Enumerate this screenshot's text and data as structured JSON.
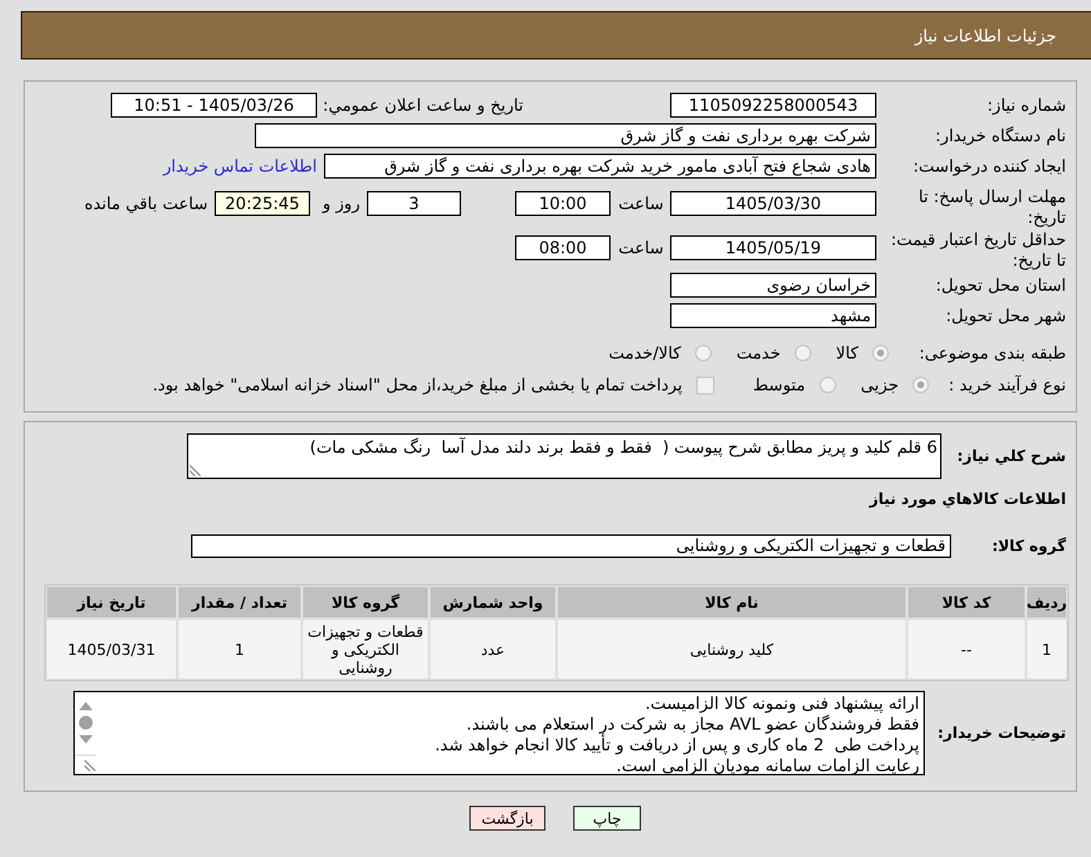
{
  "header": {
    "title": "جزئیات اطلاعات نیاز"
  },
  "details": {
    "need_number": {
      "label": "شماره نیاز:",
      "value": "1105092258000543"
    },
    "announcement": {
      "label": "تاریخ و ساعت اعلان عمومي:",
      "value": "1405/03/26 - 10:51"
    },
    "buyer_org": {
      "label": "نام دستگاه خریدار:",
      "value": "شرکت بهره برداری نفت و گاز شرق"
    },
    "requester": {
      "label": "ایجاد کننده درخواست:",
      "value": "هادی شجاع فتح آبادی مامور خرید شرکت بهره برداری نفت و گاز شرق",
      "contact_link": "اطلاعات تماس خریدار"
    },
    "reply_deadline": {
      "label": "مهلت ارسال پاسخ: تا تاریخ:",
      "date": "1405/03/30",
      "time_label": "ساعت",
      "time": "10:00",
      "days": "3",
      "days_label": "روز و",
      "remaining_time": "20:25:45",
      "remaining_label": "ساعت باقي مانده"
    },
    "price_validity": {
      "label": "حداقل تاریخ اعتبار قیمت: تا تاریخ:",
      "date": "1405/05/19",
      "time_label": "ساعت",
      "time": "08:00"
    },
    "province": {
      "label": "استان محل تحویل:",
      "value": "خراسان رضوی"
    },
    "city": {
      "label": "شهر محل تحویل:",
      "value": "مشهد"
    },
    "category": {
      "label": "طبقه بندی موضوعی:",
      "options": [
        {
          "label": "کالا",
          "selected": true,
          "disabled": true
        },
        {
          "label": "خدمت",
          "selected": false,
          "disabled": true
        },
        {
          "label": "کالا/خدمت",
          "selected": false,
          "disabled": true
        }
      ]
    },
    "purchase_process": {
      "label": "نوع فرآیند خرید :",
      "options": [
        {
          "label": "جزیی",
          "selected": true,
          "disabled": true
        },
        {
          "label": "متوسط",
          "selected": false,
          "disabled": true
        }
      ],
      "treasury_option": {
        "label": "پرداخت تمام یا بخشی از مبلغ خرید،از محل \"اسناد خزانه اسلامی\" خواهد بود.",
        "checked": false,
        "disabled": true
      }
    }
  },
  "summary": {
    "label": "شرح کلي نیاز:",
    "value": "6 قلم کلید و پریز مطابق شرح پیوست (  فقط و فقط برند دلند مدل آسا  رنگ مشکی مات)"
  },
  "goods": {
    "title": "اطلاعات کالاهاي مورد نیاز",
    "group_label": "گروه کالا:",
    "group_value": "قطعات و تجهیزات الکتریکی و روشنایی",
    "table": {
      "columns": [
        "ردیف",
        "کد کالا",
        "نام کالا",
        "واحد شمارش",
        "گروه کالا",
        "تعداد / مقدار",
        "تاریخ نیاز"
      ],
      "rows": [
        [
          "1",
          "--",
          "کلید روشنایی",
          "عدد",
          "قطعات و تجهیزات الکتریکی و روشنایی",
          "1",
          "1405/03/31"
        ]
      ]
    }
  },
  "notes": {
    "label": "توضیحات خریدار:",
    "lines": [
      "ارائه پیشنهاد فنی ونمونه کالا الزامیست.",
      "فقط فروشندگان عضو AVL مجاز به شرکت در استعلام می باشند.",
      "پرداخت طی  2 ماه کاری و پس از دریافت و تأیید کالا انجام خواهد شد.",
      "رعایت الزامات سامانه مودیان الزامی است."
    ]
  },
  "buttons": [
    {
      "label": "چاپ",
      "kind": "print"
    },
    {
      "label": "بازگشت",
      "kind": "back"
    }
  ]
}
